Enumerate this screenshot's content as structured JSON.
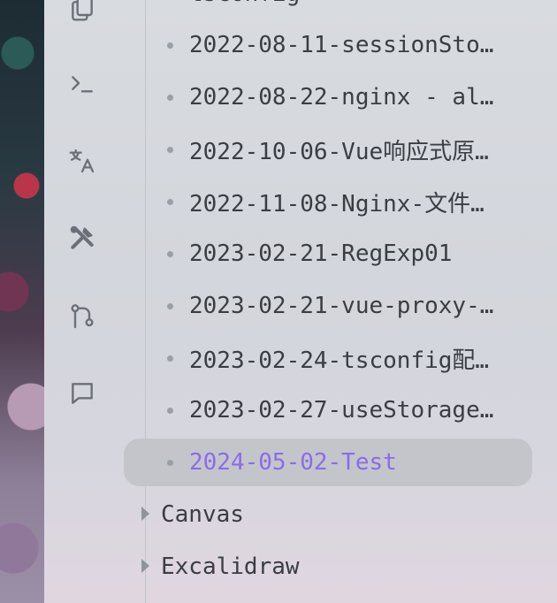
{
  "ribbon": {
    "icons": [
      "copy-icon",
      "terminal-icon",
      "translate-icon",
      "tools-icon",
      "git-branch-icon",
      "chat-icon"
    ]
  },
  "tree": {
    "partial_top_label": "tsconfig",
    "files": [
      {
        "label": "2022-08-11-sessionSto…"
      },
      {
        "label": "2022-08-22-nginx - al…"
      },
      {
        "label": "2022-10-06-Vue响应式原…"
      },
      {
        "label": "2022-11-08-Nginx-文件…"
      },
      {
        "label": "2023-02-21-RegExp01"
      },
      {
        "label": "2023-02-21-vue-proxy-…"
      },
      {
        "label": "2023-02-24-tsconfig配…"
      },
      {
        "label": "2023-02-27-useStorage…"
      },
      {
        "label": "2024-05-02-Test"
      }
    ],
    "active_index": 8,
    "folders": [
      {
        "label": "Canvas"
      },
      {
        "label": "Excalidraw"
      }
    ]
  },
  "colors": {
    "active_text": "#8b6bea",
    "active_bg": "#c3c5ca",
    "text": "#3a3d42",
    "icon": "#6b7078"
  }
}
